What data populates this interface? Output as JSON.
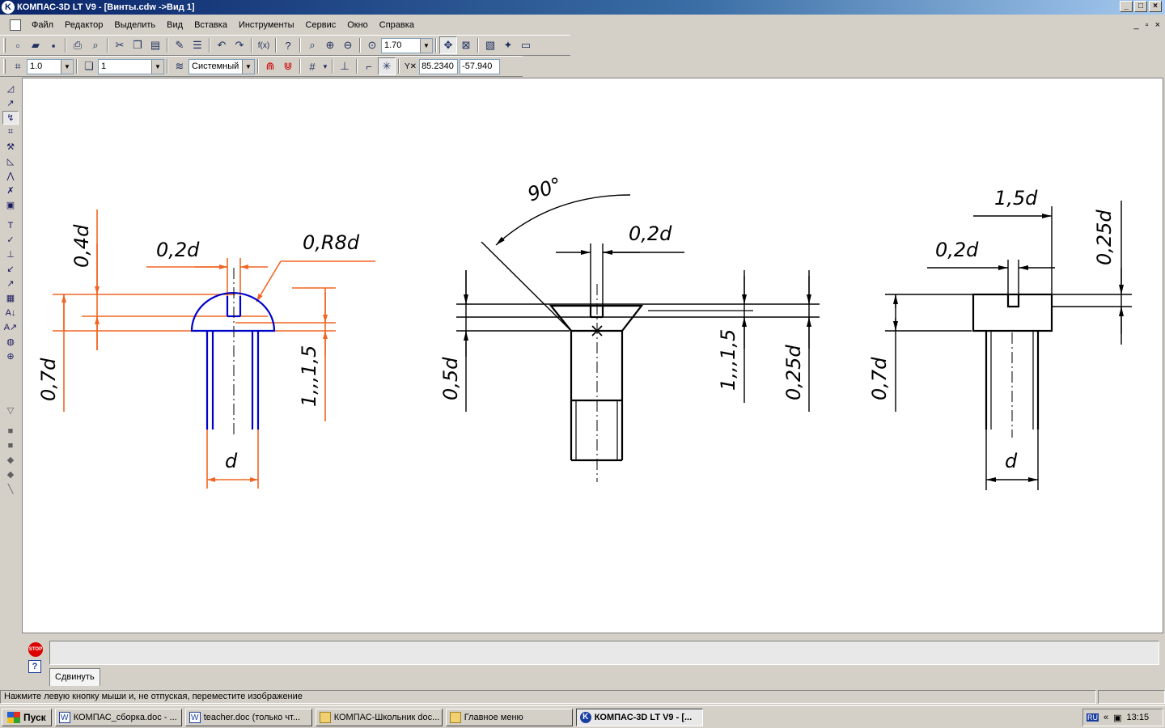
{
  "window": {
    "title": "КОМПАС-3D LT V9 - [Винты.cdw ->Вид 1]",
    "min": "_",
    "max": "□",
    "close": "×"
  },
  "menu": {
    "items": [
      "Файл",
      "Редактор",
      "Выделить",
      "Вид",
      "Вставка",
      "Инструменты",
      "Сервис",
      "Окно",
      "Справка"
    ],
    "mdi_min": "_",
    "mdi_max": "▫",
    "mdi_close": "×"
  },
  "toolbar1": {
    "zoom_value": "1.70",
    "fx_label": "f(x)"
  },
  "toolbar2": {
    "step_value": "1.0",
    "layer_value": "1",
    "style_value": "Системный",
    "x_coord": "85.2340",
    "y_coord": "-57.940"
  },
  "drawing": {
    "view1": {
      "label_0_4d": "0,4d",
      "label_0_2d": "0,2d",
      "label_0_R8d": "0,R8d",
      "label_0_7d": "0,7d",
      "label_1_1_5": "1,,,1,5",
      "label_d": "d"
    },
    "view2": {
      "label_90": "90°",
      "label_0_2d": "0,2d",
      "label_0_5d": "0,5d",
      "label_1_1_5": "1,,,1,5",
      "label_0_25d": "0,25d"
    },
    "view3": {
      "label_1_5d": "1,5d",
      "label_0_2d": "0,2d",
      "label_0_25d": "0,25d",
      "label_0_7d": "0,7d",
      "label_d": "d"
    },
    "colors": {
      "dimension": "#f26522",
      "contour": "#0000cc",
      "line": "#000000"
    }
  },
  "command_panel": {
    "tab_label": "Сдвинуть",
    "stop_label": "STOP",
    "help_label": "?"
  },
  "status": {
    "hint": "Нажмите левую кнопку мыши и, не отпуская, переместите изображение"
  },
  "taskbar": {
    "start_label": "Пуск",
    "tasks": [
      "КОМПАС_сборка.doc - ...",
      "teacher.doc (только чт...",
      "КОМПАС-Школьник doc...",
      "Главное меню",
      "КОМПАС-3D LT V9 - [..."
    ],
    "lang": "RU",
    "arrows": "«",
    "clock": "13:15"
  }
}
